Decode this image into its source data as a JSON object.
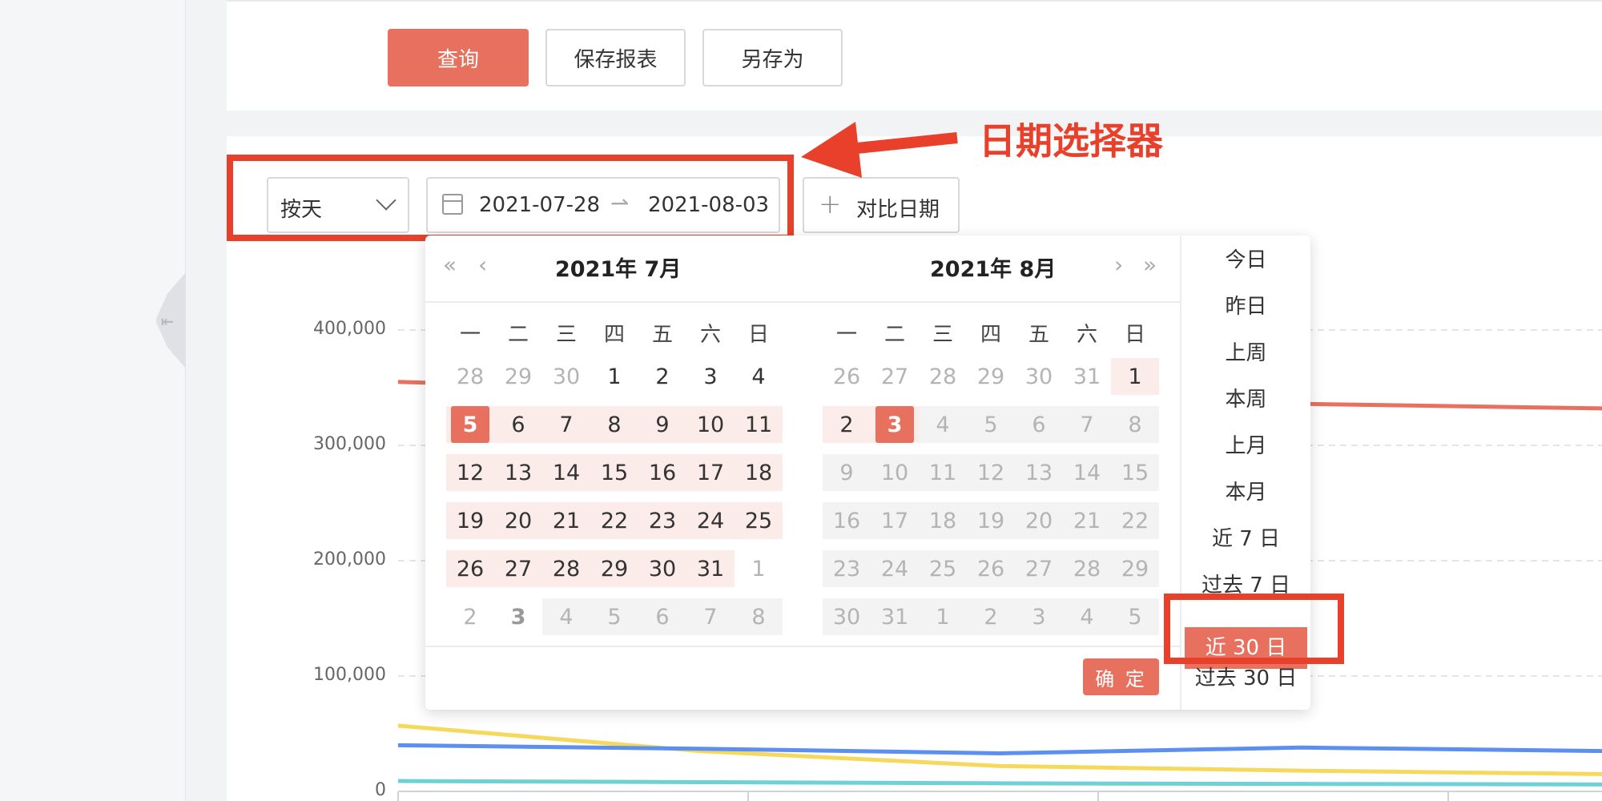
{
  "sidebar": {
    "collapse_glyph": "⇤"
  },
  "toolbar": {
    "query_label": "查询",
    "save_report_label": "保存报表",
    "save_as_label": "另存为"
  },
  "filters": {
    "granularity": "按天",
    "range_start": "2021-07-28",
    "range_end": "2021-08-03",
    "range_separator": "⇀",
    "compare_label": "对比日期"
  },
  "annotation": {
    "label": "日期选择器",
    "color": "#e8402b"
  },
  "picker": {
    "left_title": "2021年 7月",
    "right_title": "2021年 8月",
    "weekdays": [
      "一",
      "二",
      "三",
      "四",
      "五",
      "六",
      "日"
    ],
    "confirm_label": "确 定",
    "presets": [
      "今日",
      "昨日",
      "上周",
      "本周",
      "上月",
      "本月",
      "近 7 日",
      "过去 7 日",
      "近 30 日",
      "过去 30 日"
    ],
    "active_preset": "近 30 日"
  },
  "chart_data": {
    "type": "line",
    "yticks": [
      "400,000",
      "300,000",
      "200,000",
      "100,000",
      "0"
    ],
    "ylim": [
      0,
      400000
    ],
    "grid": true,
    "series": [
      {
        "color": "#e8705f",
        "values": [
          355000,
          348000,
          342000,
          336000,
          332000
        ]
      },
      {
        "color": "#f6d95c",
        "values": [
          57000,
          35000,
          22000,
          18000,
          15000
        ]
      },
      {
        "color": "#5b8ff0",
        "values": [
          40000,
          37000,
          33000,
          38000,
          35000
        ]
      },
      {
        "color": "#6fd1d6",
        "values": [
          9000,
          8000,
          7000,
          6500,
          6000
        ]
      }
    ]
  }
}
